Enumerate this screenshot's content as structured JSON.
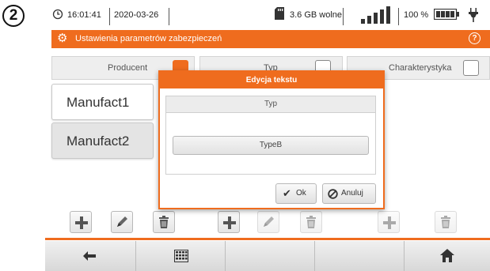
{
  "step_badge": "2",
  "status": {
    "time": "16:01:41",
    "date": "2020-03-26",
    "storage": "3.6 GB wolne",
    "battery": "100 %",
    "icons": [
      "clock-icon",
      "sd-card-icon",
      "signal-icon",
      "battery-icon",
      "plug-icon"
    ]
  },
  "titlebar": {
    "title": "Ustawienia parametrów zabezpieczeń",
    "icons": [
      "settings-icon",
      "help-icon"
    ]
  },
  "columns": [
    {
      "label": "Producent",
      "state": "active"
    },
    {
      "label": "Typ",
      "state": "inactive"
    },
    {
      "label": "Charakterystyka",
      "state": "inactive"
    }
  ],
  "list_items": [
    "Manufact1",
    "Manufact2"
  ],
  "dialog": {
    "title": "Edycja tekstu",
    "field_label": "Typ",
    "field_value": "TypeB",
    "ok_label": "Ok",
    "cancel_label": "Anuluj"
  },
  "toolbar_icons": [
    "add-icon",
    "edit-icon",
    "delete-icon"
  ],
  "bottom_icons": [
    "back-arrow-icon",
    "keyboard-icon",
    "home-icon"
  ],
  "colors": {
    "accent": "#ef6c1e",
    "bar": "#e0e0e0"
  }
}
